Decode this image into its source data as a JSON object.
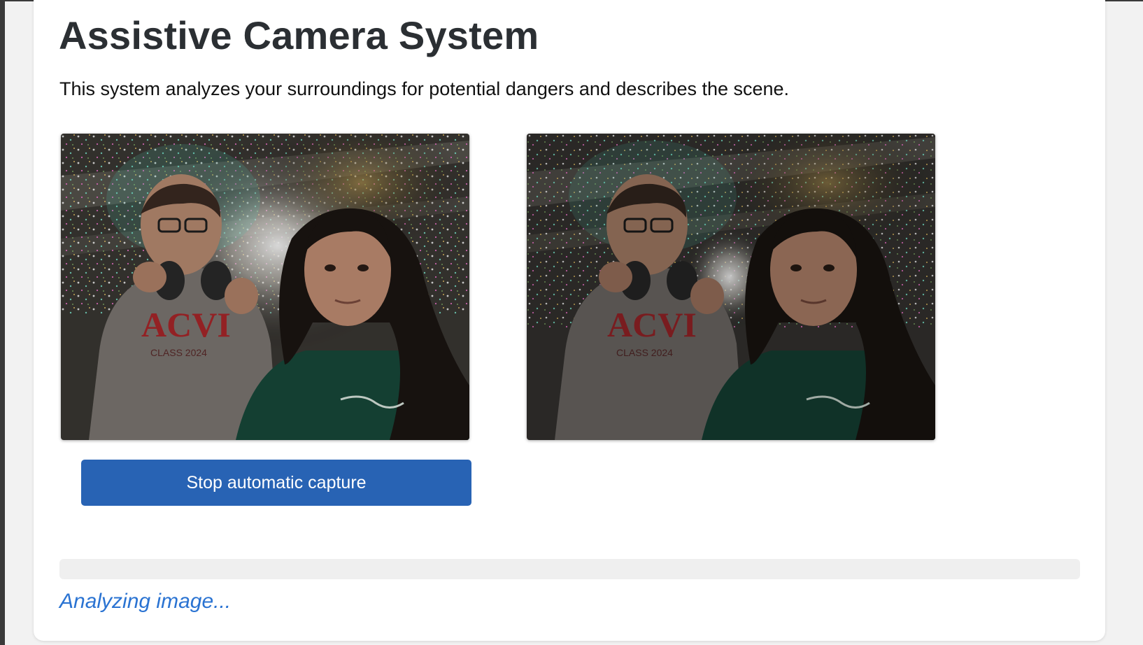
{
  "page": {
    "title": "Assistive Camera System",
    "description": "This system analyzes your surroundings for potential dangers and describes the scene."
  },
  "camera": {
    "live_feed_alt": "Live camera feed",
    "captured_frame_alt": "Last captured frame",
    "shirt_text": "ACVI",
    "shirt_subtext": "CLASS 2024"
  },
  "controls": {
    "capture_button_label": "Stop automatic capture"
  },
  "status": {
    "progress": 0,
    "message": "Analyzing image..."
  },
  "colors": {
    "accent": "#2863b4",
    "status_text": "#2a73d2",
    "title_text": "#2b2f33"
  }
}
